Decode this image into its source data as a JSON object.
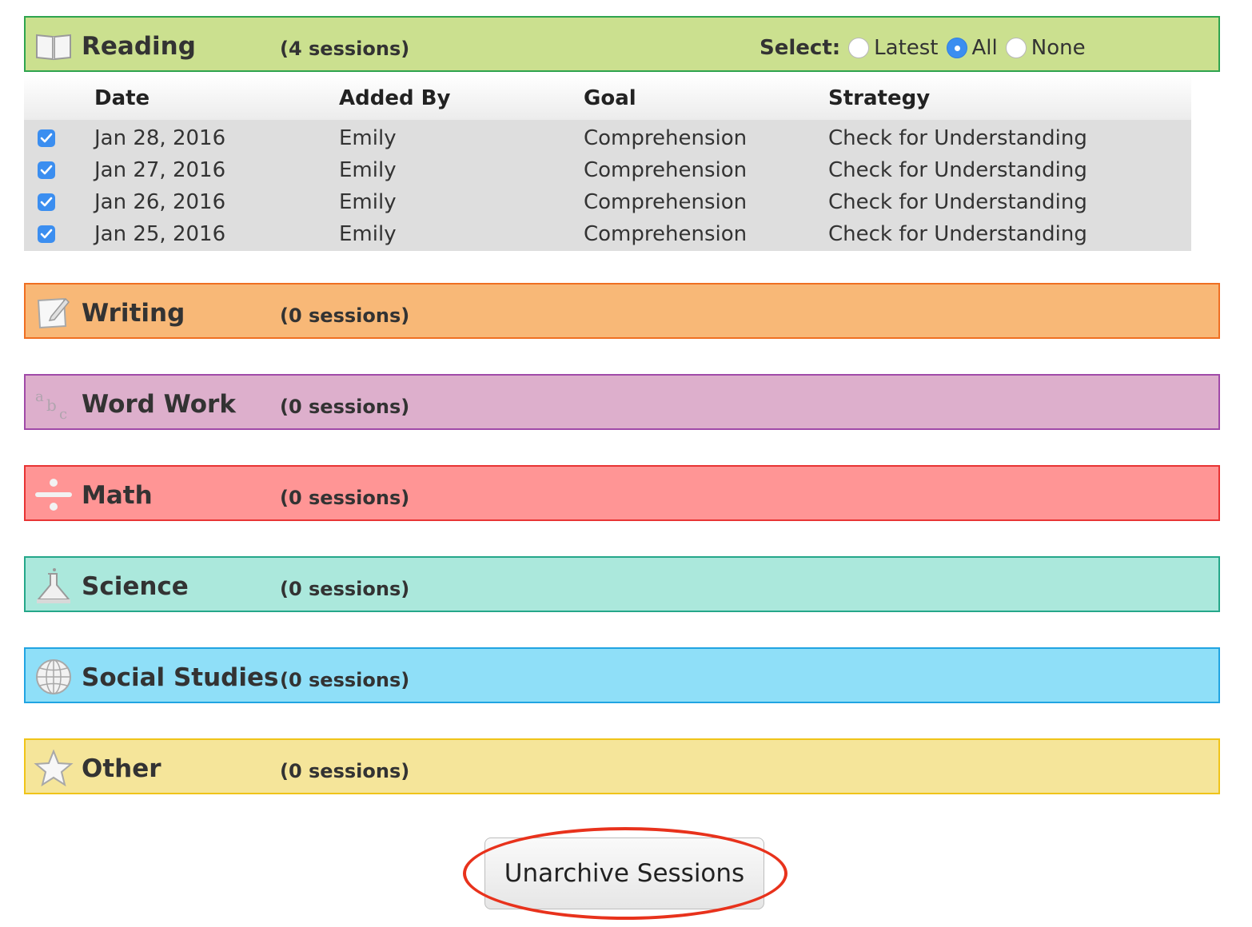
{
  "reading": {
    "title": "Reading",
    "count": "(4 sessions)",
    "color": "#cbe08f",
    "border": "#2fa44f",
    "icon": "book-icon",
    "select": {
      "label": "Select:",
      "options": [
        "Latest",
        "All",
        "None"
      ],
      "selected": "All"
    },
    "table": {
      "headers": [
        "Date",
        "Added By",
        "Goal",
        "Strategy"
      ],
      "rows": [
        {
          "checked": true,
          "date": "Jan 28, 2016",
          "added_by": "Emily",
          "goal": "Comprehension",
          "strategy": "Check for Understanding"
        },
        {
          "checked": true,
          "date": "Jan 27, 2016",
          "added_by": "Emily",
          "goal": "Comprehension",
          "strategy": "Check for Understanding"
        },
        {
          "checked": true,
          "date": "Jan 26, 2016",
          "added_by": "Emily",
          "goal": "Comprehension",
          "strategy": "Check for Understanding"
        },
        {
          "checked": true,
          "date": "Jan 25, 2016",
          "added_by": "Emily",
          "goal": "Comprehension",
          "strategy": "Check for Understanding"
        }
      ]
    }
  },
  "sections": [
    {
      "title": "Writing",
      "count": "(0 sessions)",
      "color": "#f8b877",
      "border": "#ef6f22",
      "icon": "paper-pencil-icon"
    },
    {
      "title": "Word Work",
      "count": "(0 sessions)",
      "color": "#ddafcc",
      "border": "#a04aa8",
      "icon": "abc-icon"
    },
    {
      "title": "Math",
      "count": "(0 sessions)",
      "color": "#ff9595",
      "border": "#e83434",
      "icon": "divide-icon"
    },
    {
      "title": "Science",
      "count": "(0 sessions)",
      "color": "#abe8dc",
      "border": "#25a78a",
      "icon": "flask-icon"
    },
    {
      "title": "Social Studies",
      "count": "(0 sessions)",
      "color": "#8fdff8",
      "border": "#21a4e2",
      "icon": "globe-icon"
    },
    {
      "title": "Other",
      "count": "(0 sessions)",
      "color": "#f5e59a",
      "border": "#f0c419",
      "icon": "star-icon"
    }
  ],
  "unarchive_button": {
    "label": "Unarchive Sessions"
  }
}
